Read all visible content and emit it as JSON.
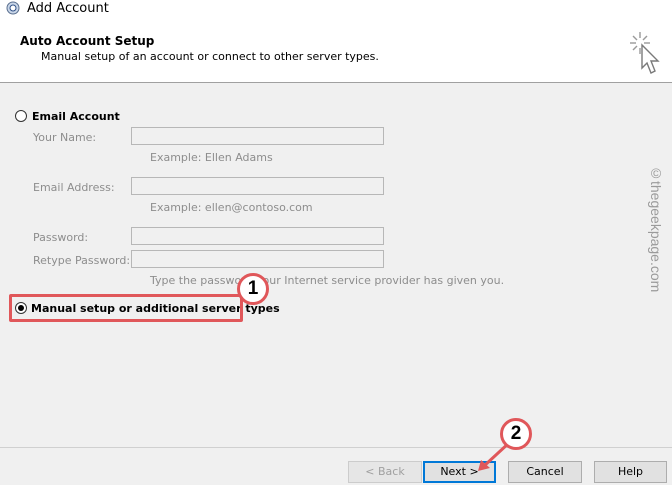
{
  "window": {
    "title": "Add Account",
    "icon": "outlook-icon"
  },
  "header": {
    "title": "Auto Account Setup",
    "subtitle": "Manual setup of an account or connect to other server types.",
    "icon": "wizard-cursor-icon"
  },
  "email_account": {
    "label": "Email Account",
    "selected": false,
    "your_name": {
      "label": "Your Name:",
      "value": "",
      "example": "Example: Ellen Adams"
    },
    "email_address": {
      "label": "Email Address:",
      "value": "",
      "example": "Example: ellen@contoso.com"
    },
    "password": {
      "label": "Password:",
      "value": ""
    },
    "retype_password": {
      "label": "Retype Password:",
      "value": ""
    },
    "password_hint": "Type the password your Internet service provider has given you."
  },
  "manual_setup": {
    "label": "Manual setup or additional server types",
    "selected": true
  },
  "callouts": {
    "one": "1",
    "two": "2"
  },
  "watermark": "©thegeekpage.com",
  "buttons": {
    "back": "< Back",
    "next": "Next >",
    "cancel": "Cancel",
    "help": "Help"
  },
  "colors": {
    "highlight": "#e0575a",
    "default_button_border": "#0078d7"
  }
}
